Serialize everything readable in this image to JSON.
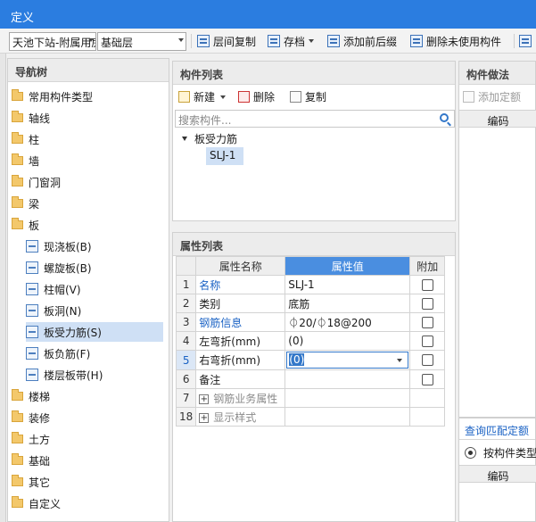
{
  "window": {
    "title": "定义"
  },
  "toolbar": {
    "floor_combo": "天池下站-附属用房",
    "layer_combo": "基础层",
    "copy_between_floors": "层间复制",
    "archive": "存档",
    "add_prefix_suffix": "添加前后缀",
    "delete_unused": "删除未使用构件"
  },
  "nav": {
    "title": "导航树",
    "items": [
      {
        "label": "常用构件类型",
        "icon": "folder-icon"
      },
      {
        "label": "轴线",
        "icon": "folder-icon"
      },
      {
        "label": "柱",
        "icon": "folder-icon"
      },
      {
        "label": "墙",
        "icon": "folder-icon"
      },
      {
        "label": "门窗洞",
        "icon": "folder-icon"
      },
      {
        "label": "梁",
        "icon": "folder-icon"
      },
      {
        "label": "板",
        "icon": "folder-open-icon"
      },
      {
        "label": "现浇板(B)",
        "icon": "cast-slab-icon"
      },
      {
        "label": "螺旋板(B)",
        "icon": "spiral-slab-icon"
      },
      {
        "label": "柱帽(V)",
        "icon": "column-cap-icon"
      },
      {
        "label": "板洞(N)",
        "icon": "slab-hole-icon"
      },
      {
        "label": "板受力筋(S)",
        "icon": "slab-rebar-icon"
      },
      {
        "label": "板负筋(F)",
        "icon": "negative-rebar-icon"
      },
      {
        "label": "楼层板带(H)",
        "icon": "slab-strip-icon"
      },
      {
        "label": "楼梯",
        "icon": "folder-icon"
      },
      {
        "label": "装修",
        "icon": "folder-icon"
      },
      {
        "label": "土方",
        "icon": "folder-icon"
      },
      {
        "label": "基础",
        "icon": "folder-icon"
      },
      {
        "label": "其它",
        "icon": "folder-icon"
      },
      {
        "label": "自定义",
        "icon": "folder-icon"
      }
    ]
  },
  "components": {
    "title": "构件列表",
    "new_label": "新建",
    "delete_label": "删除",
    "copy_label": "复制",
    "search_placeholder": "搜索构件...",
    "tree": {
      "group": "板受力筋",
      "item": "SLJ-1"
    }
  },
  "properties": {
    "title": "属性列表",
    "headers": [
      "属性名称",
      "属性值",
      "附加"
    ],
    "rows": [
      {
        "num": "1",
        "name": "名称",
        "value": "SLJ-1"
      },
      {
        "num": "2",
        "name": "类别",
        "value": "底筋"
      },
      {
        "num": "3",
        "name": "钢筋信息",
        "value": "⏀20/⏀18@200"
      },
      {
        "num": "4",
        "name": "左弯折(mm)",
        "value": "(0)"
      },
      {
        "num": "5",
        "name": "右弯折(mm)",
        "value": "(0)"
      },
      {
        "num": "6",
        "name": "备注",
        "value": ""
      },
      {
        "num": "7",
        "name": "钢筋业务属性",
        "value": ""
      },
      {
        "num": "18",
        "name": "显示样式",
        "value": ""
      }
    ]
  },
  "method": {
    "title": "构件做法",
    "add_quota": "添加定额",
    "code_header": "编码"
  },
  "query": {
    "title": "查询匹配定额",
    "radio_label": "按构件类型",
    "code_header": "编码"
  },
  "colors": {
    "accent": "#2b7de0",
    "selected_row": "#cfe0f5",
    "link": "#1a62c4"
  }
}
